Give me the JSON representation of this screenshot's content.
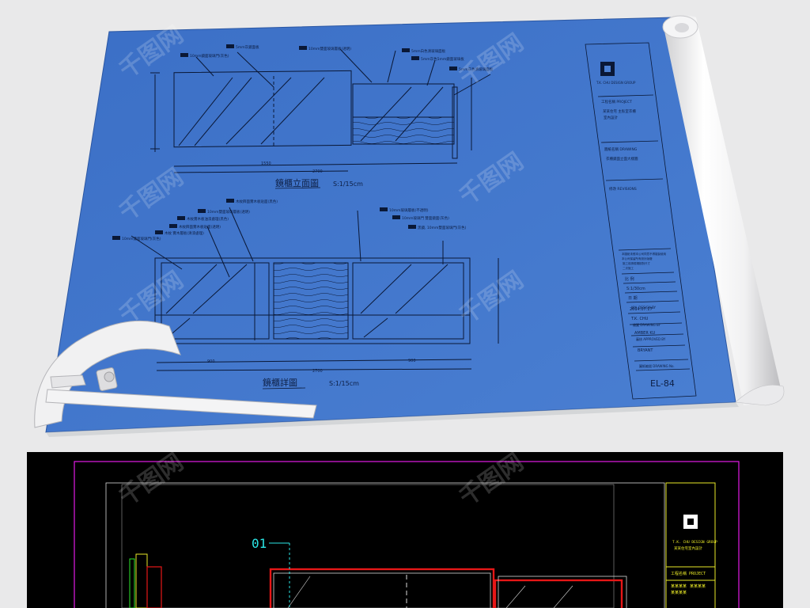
{
  "upper_sheet": {
    "elevation_title": "鏡櫃立面圖",
    "elevation_scale": "S:1/15cm",
    "detail_title": "鏡櫃詳圖",
    "detail_scale": "S:1/15cm",
    "elevation_dims": {
      "bottom_total": "2700",
      "bottom_left": "1550"
    },
    "detail_dims": {
      "bottom_total": "2700",
      "bottom_left": "900",
      "bottom_mid": "900"
    },
    "elevation_notes": [
      "5mm灰鏡面板",
      "10mm鏡面玻璃門(灰色)",
      "10mm雙面玻璃層板(透明)",
      "5mm白色清玻璃面板",
      "5mm灰色5mm鏡面玻璃板",
      "5mm灰色清玻璃面板"
    ],
    "detail_notes": [
      "木紋飾面實木板貼面(黑色)",
      "10mm雙面玻璃層板(透明)",
      "木紋實木板油漆處理(黑色)",
      "木紋飾面實木板貼面(透明)",
      "木紋 實木層板(清漆處理)",
      "10mm雙面玻璃門(灰色)",
      "10mm玻璃層板(不透明)",
      "10mm玻璃門 雙面鏡面(灰色)",
      "黑鏡, 10mm雙面玻璃門(灰色)"
    ],
    "title_block": {
      "company": "T.K. CHU DESIGN GROUP",
      "project_label": "工程名稱 PROJECT",
      "project_lines": [
        "某某住宅  主臥室衣櫃",
        "室內設計"
      ],
      "drawing_label": "圖紙名稱 DRAWING",
      "drawing_name": "衣櫃鏡面立面大樣圖",
      "revision_label": "修改 REVISIONS",
      "notes": [
        "本圖紙未經本公司同意不得複製使用",
        "本公司保留所有設計版權",
        "施工前請現場核對尺寸",
        "二次施工"
      ],
      "scale_label": "比 例",
      "scale_value": "S:1/30cm",
      "date_label": "日 期",
      "date_value": "2014.07.17",
      "design_label": "設計 DESIGN BY",
      "design_value": "T.K. CHU",
      "drawn_label": "繪圖 DRAWING BY",
      "drawn_value": "AMBER KU",
      "approved_label": "審核 APPROVED BY",
      "approved_value": "BRYANT",
      "drawing_no_label": "圖紙編號 DRAWING No.",
      "drawing_no": "EL-84"
    }
  },
  "lower_cad": {
    "marker": "01",
    "company": "T.K. CHU DESIGN GROUP",
    "company_vertical": "T.K.CHU",
    "subtitle": "某某住宅室內設計",
    "project_row": "工程名稱  PROJECT",
    "row2_a": "某某某某",
    "row2_b": "某某某某",
    "row3": "某某某某"
  },
  "watermark": "千图网",
  "colors": {
    "blueprint": "#3e72c8",
    "blueprint_line": "#0a1836",
    "cad_bg": "#000000",
    "cad_magenta": "#e21ae6",
    "cad_yellow": "#e8e827",
    "cad_red": "#e61717",
    "cad_cyan": "#2be6e6",
    "cad_white": "#d9d9d9"
  }
}
